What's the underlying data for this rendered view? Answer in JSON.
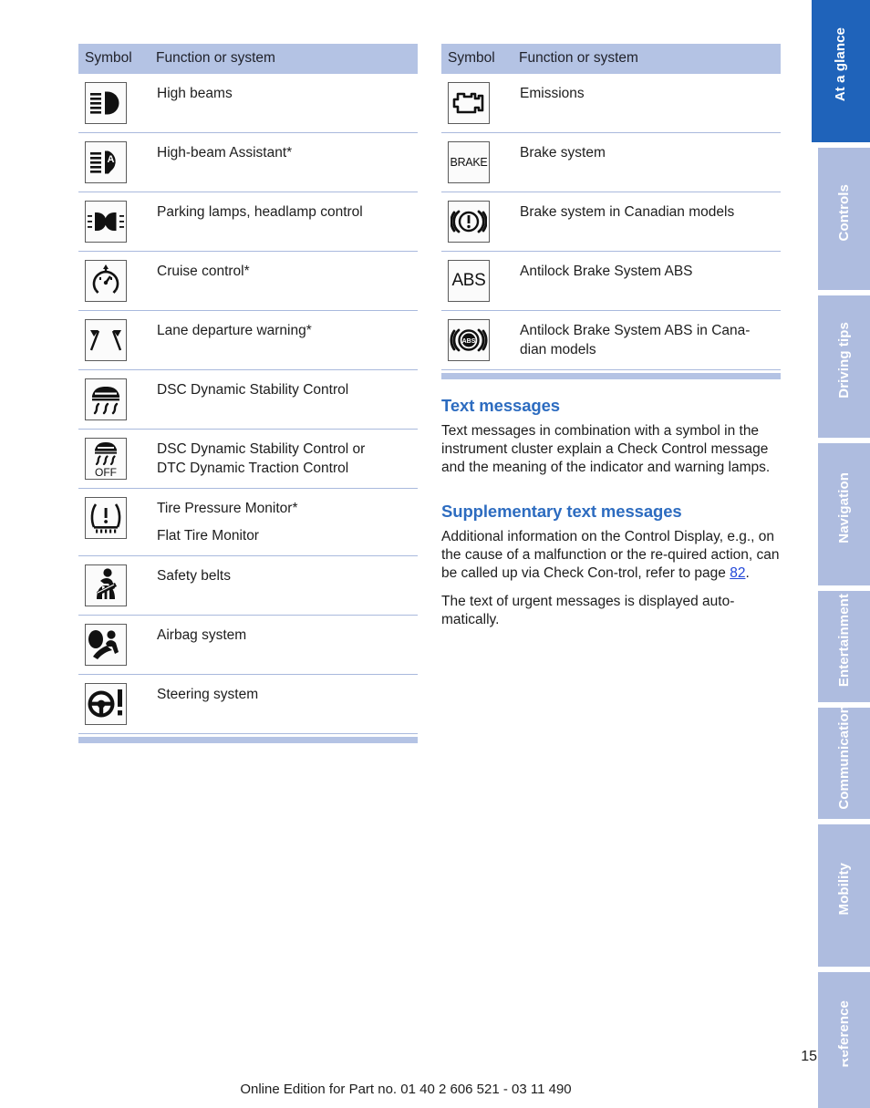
{
  "left_table": {
    "headers": {
      "symbol": "Symbol",
      "function": "Function or system"
    },
    "rows": [
      {
        "icon": "high-beams-icon",
        "lines": [
          "High beams"
        ]
      },
      {
        "icon": "high-beam-assistant-icon",
        "lines": [
          "High-beam Assistant*"
        ]
      },
      {
        "icon": "parking-lamps-headlamp-control-icon",
        "lines": [
          "Parking lamps, headlamp control"
        ]
      },
      {
        "icon": "cruise-control-icon",
        "lines": [
          "Cruise control*"
        ]
      },
      {
        "icon": "lane-departure-warning-icon",
        "lines": [
          "Lane departure warning*"
        ]
      },
      {
        "icon": "dsc-dynamic-stability-control-icon",
        "lines": [
          "DSC Dynamic Stability Control"
        ]
      },
      {
        "icon": "dsc-dtc-off-icon",
        "lines": [
          "DSC Dynamic Stability Control or",
          "DTC Dynamic Traction Control"
        ]
      },
      {
        "icon": "tire-pressure-monitor-icon",
        "lines": [
          "Tire Pressure Monitor*",
          "Flat Tire Monitor"
        ]
      },
      {
        "icon": "safety-belts-icon",
        "lines": [
          "Safety belts"
        ]
      },
      {
        "icon": "airbag-system-icon",
        "lines": [
          "Airbag system"
        ]
      },
      {
        "icon": "steering-system-icon",
        "lines": [
          "Steering system"
        ]
      }
    ]
  },
  "right_table": {
    "headers": {
      "symbol": "Symbol",
      "function": "Function or system"
    },
    "rows": [
      {
        "icon": "emissions-engine-icon",
        "lines": [
          "Emissions"
        ]
      },
      {
        "icon": "brake-system-icon",
        "label": "BRAKE",
        "lines": [
          "Brake system"
        ]
      },
      {
        "icon": "brake-system-canadian-icon",
        "lines": [
          "Brake system in Canadian models"
        ]
      },
      {
        "icon": "abs-icon",
        "label": "ABS",
        "lines": [
          "Antilock Brake System ABS"
        ]
      },
      {
        "icon": "abs-canadian-icon",
        "label": "ABS",
        "lines": [
          "Antilock Brake System ABS in Cana-",
          "dian models"
        ]
      }
    ]
  },
  "sections": [
    {
      "heading": "Text messages",
      "paragraphs": [
        "Text messages in combination with a symbol in the instrument cluster explain a Check Control message and the meaning of the indicator and warning lamps."
      ]
    },
    {
      "heading": "Supplementary text messages",
      "paragraph_parts": {
        "before_link": "Additional information on the Control Display, e.g., on the cause of a malfunction or the re-quired action, can be called up via Check Con-trol, refer to page ",
        "link": "82",
        "after_link": "."
      },
      "paragraphs": [
        "The text of urgent messages is displayed auto-matically."
      ]
    }
  ],
  "sec2_p1_line1": "Additional information on the Control Display,",
  "sec2_p1_line2": "e.g., on the cause of a malfunction or the re-",
  "sec2_p1_line3": "quired action, can be called up via Check Con-",
  "sec2_p1_line4a": "trol, refer to page ",
  "sec2_p1_link": "82",
  "sec2_p1_line4b": ".",
  "tabs": [
    {
      "label": "At a glance",
      "active": true
    },
    {
      "label": "Controls",
      "active": false
    },
    {
      "label": "Driving tips",
      "active": false
    },
    {
      "label": "Navigation",
      "active": false
    },
    {
      "label": "Entertainment",
      "active": false
    },
    {
      "label": "Communication",
      "active": false
    },
    {
      "label": "Mobility",
      "active": false
    },
    {
      "label": "Reference",
      "active": false
    }
  ],
  "footer": {
    "page_number": "15",
    "edition_text": "Online Edition for Part no. 01 40 2 606 521 - 03 11 490"
  },
  "colors": {
    "accent_blue": "#2d6cc0",
    "tab_active": "#1f63ba",
    "tab_inactive": "#aebcdf",
    "header_band": "#b4c3e4",
    "rule": "#a9b9dd",
    "xref_link": "#2146d8"
  }
}
